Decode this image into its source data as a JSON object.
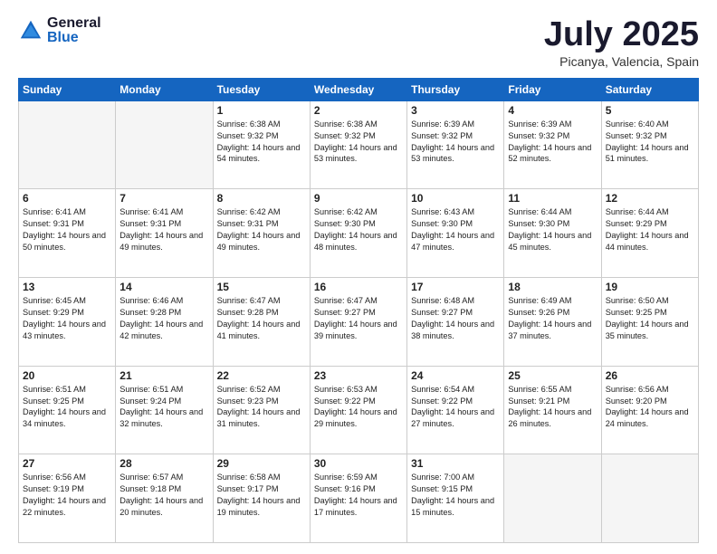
{
  "logo": {
    "general": "General",
    "blue": "Blue"
  },
  "header": {
    "month": "July 2025",
    "location": "Picanya, Valencia, Spain"
  },
  "weekdays": [
    "Sunday",
    "Monday",
    "Tuesday",
    "Wednesday",
    "Thursday",
    "Friday",
    "Saturday"
  ],
  "weeks": [
    [
      {
        "day": "",
        "text": ""
      },
      {
        "day": "",
        "text": ""
      },
      {
        "day": "1",
        "text": "Sunrise: 6:38 AM\nSunset: 9:32 PM\nDaylight: 14 hours and 54 minutes."
      },
      {
        "day": "2",
        "text": "Sunrise: 6:38 AM\nSunset: 9:32 PM\nDaylight: 14 hours and 53 minutes."
      },
      {
        "day": "3",
        "text": "Sunrise: 6:39 AM\nSunset: 9:32 PM\nDaylight: 14 hours and 53 minutes."
      },
      {
        "day": "4",
        "text": "Sunrise: 6:39 AM\nSunset: 9:32 PM\nDaylight: 14 hours and 52 minutes."
      },
      {
        "day": "5",
        "text": "Sunrise: 6:40 AM\nSunset: 9:32 PM\nDaylight: 14 hours and 51 minutes."
      }
    ],
    [
      {
        "day": "6",
        "text": "Sunrise: 6:41 AM\nSunset: 9:31 PM\nDaylight: 14 hours and 50 minutes."
      },
      {
        "day": "7",
        "text": "Sunrise: 6:41 AM\nSunset: 9:31 PM\nDaylight: 14 hours and 49 minutes."
      },
      {
        "day": "8",
        "text": "Sunrise: 6:42 AM\nSunset: 9:31 PM\nDaylight: 14 hours and 49 minutes."
      },
      {
        "day": "9",
        "text": "Sunrise: 6:42 AM\nSunset: 9:30 PM\nDaylight: 14 hours and 48 minutes."
      },
      {
        "day": "10",
        "text": "Sunrise: 6:43 AM\nSunset: 9:30 PM\nDaylight: 14 hours and 47 minutes."
      },
      {
        "day": "11",
        "text": "Sunrise: 6:44 AM\nSunset: 9:30 PM\nDaylight: 14 hours and 45 minutes."
      },
      {
        "day": "12",
        "text": "Sunrise: 6:44 AM\nSunset: 9:29 PM\nDaylight: 14 hours and 44 minutes."
      }
    ],
    [
      {
        "day": "13",
        "text": "Sunrise: 6:45 AM\nSunset: 9:29 PM\nDaylight: 14 hours and 43 minutes."
      },
      {
        "day": "14",
        "text": "Sunrise: 6:46 AM\nSunset: 9:28 PM\nDaylight: 14 hours and 42 minutes."
      },
      {
        "day": "15",
        "text": "Sunrise: 6:47 AM\nSunset: 9:28 PM\nDaylight: 14 hours and 41 minutes."
      },
      {
        "day": "16",
        "text": "Sunrise: 6:47 AM\nSunset: 9:27 PM\nDaylight: 14 hours and 39 minutes."
      },
      {
        "day": "17",
        "text": "Sunrise: 6:48 AM\nSunset: 9:27 PM\nDaylight: 14 hours and 38 minutes."
      },
      {
        "day": "18",
        "text": "Sunrise: 6:49 AM\nSunset: 9:26 PM\nDaylight: 14 hours and 37 minutes."
      },
      {
        "day": "19",
        "text": "Sunrise: 6:50 AM\nSunset: 9:25 PM\nDaylight: 14 hours and 35 minutes."
      }
    ],
    [
      {
        "day": "20",
        "text": "Sunrise: 6:51 AM\nSunset: 9:25 PM\nDaylight: 14 hours and 34 minutes."
      },
      {
        "day": "21",
        "text": "Sunrise: 6:51 AM\nSunset: 9:24 PM\nDaylight: 14 hours and 32 minutes."
      },
      {
        "day": "22",
        "text": "Sunrise: 6:52 AM\nSunset: 9:23 PM\nDaylight: 14 hours and 31 minutes."
      },
      {
        "day": "23",
        "text": "Sunrise: 6:53 AM\nSunset: 9:22 PM\nDaylight: 14 hours and 29 minutes."
      },
      {
        "day": "24",
        "text": "Sunrise: 6:54 AM\nSunset: 9:22 PM\nDaylight: 14 hours and 27 minutes."
      },
      {
        "day": "25",
        "text": "Sunrise: 6:55 AM\nSunset: 9:21 PM\nDaylight: 14 hours and 26 minutes."
      },
      {
        "day": "26",
        "text": "Sunrise: 6:56 AM\nSunset: 9:20 PM\nDaylight: 14 hours and 24 minutes."
      }
    ],
    [
      {
        "day": "27",
        "text": "Sunrise: 6:56 AM\nSunset: 9:19 PM\nDaylight: 14 hours and 22 minutes."
      },
      {
        "day": "28",
        "text": "Sunrise: 6:57 AM\nSunset: 9:18 PM\nDaylight: 14 hours and 20 minutes."
      },
      {
        "day": "29",
        "text": "Sunrise: 6:58 AM\nSunset: 9:17 PM\nDaylight: 14 hours and 19 minutes."
      },
      {
        "day": "30",
        "text": "Sunrise: 6:59 AM\nSunset: 9:16 PM\nDaylight: 14 hours and 17 minutes."
      },
      {
        "day": "31",
        "text": "Sunrise: 7:00 AM\nSunset: 9:15 PM\nDaylight: 14 hours and 15 minutes."
      },
      {
        "day": "",
        "text": ""
      },
      {
        "day": "",
        "text": ""
      }
    ]
  ]
}
